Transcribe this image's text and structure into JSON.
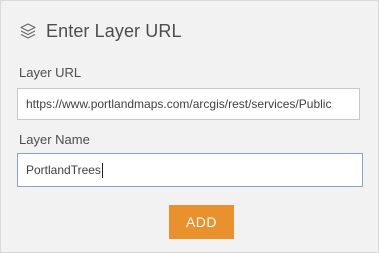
{
  "header": {
    "icon": "layers-icon",
    "title": "Enter Layer URL"
  },
  "form": {
    "url_label": "Layer URL",
    "url_value": "https://www.portlandmaps.com/arcgis/rest/services/Public",
    "name_label": "Layer Name",
    "name_value": "PortlandTrees"
  },
  "actions": {
    "add_label": "ADD"
  },
  "colors": {
    "panel_bg": "#f2f2f2",
    "button_bg": "#e8912d",
    "active_border": "#8aa4c8"
  }
}
